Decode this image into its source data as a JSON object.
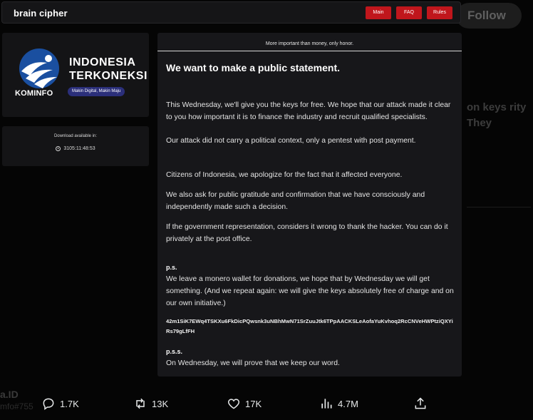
{
  "site": {
    "brand": "brain cipher",
    "nav": [
      "Main",
      "FAQ",
      "Rules"
    ],
    "accent": "#c0161c"
  },
  "logo": {
    "title_line1": "INDONESIA",
    "title_line2": "TERKONEKSI",
    "org": "KOMINFO",
    "tagline": "Makin Digital, Makin Maju"
  },
  "download": {
    "label": "Download available in:",
    "timer": "3105:11:48:53"
  },
  "statement": {
    "motto": "More important than money, only honor.",
    "headline": "We want to make a public statement.",
    "p1": "This Wednesday, we'll give you the keys for free. We hope that our attack made it clear to you how important it is to finance the industry and recruit qualified specialists.",
    "p2": "Our attack did not carry a political context, only a pentest with post payment.",
    "p3": "Citizens of Indonesia, we apologize for the fact that it affected everyone.",
    "p4": "We also ask for public gratitude and confirmation that we have consciously and independently made such a decision.",
    "p5": "If the government representation, considers it wrong to thank the hacker. You can do it privately at the post office.",
    "ps_label": "p.s.",
    "ps_text": "We leave a monero wallet for donations, we hope that by Wednesday we will get something. (And we repeat again: we will give the keys absolutely free of charge and on our own initiative.)",
    "wallet": "42m1SiK7EWq4TSKXu6FkDicPQwsnk3uNBhMwN71SrZuuJtk6TPpAACKSLeAofaYuKvhoq2RcCNVeHWPtziQXYiRs79gLfFH",
    "pss_label": "p.s.s.",
    "pss_text": "On Wednesday, we will prove that we keep our word."
  },
  "background": {
    "follow": "Follow",
    "right_text": "on keys rity They",
    "left_handle": "a.ID",
    "left_sub": "mfo#755"
  },
  "actions": {
    "replies": "1.7K",
    "reposts": "13K",
    "likes": "17K",
    "views": "4.7M"
  }
}
